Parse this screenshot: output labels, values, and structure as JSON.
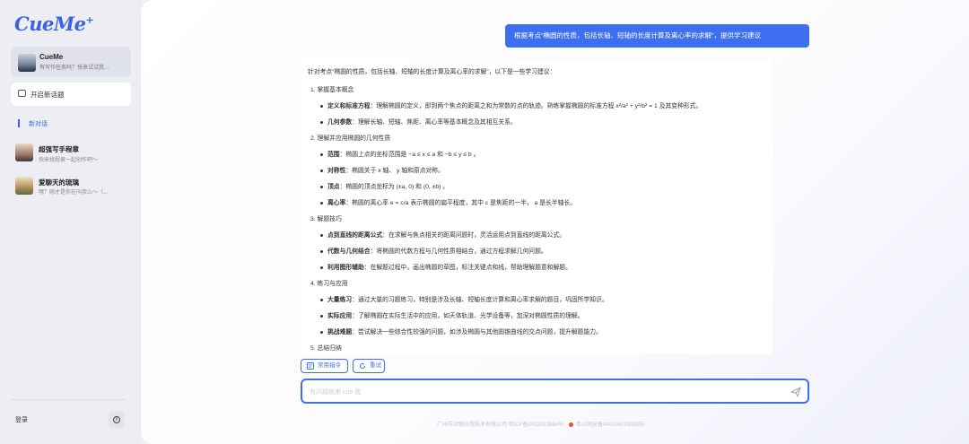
{
  "sidebar": {
    "logo": "CueMe",
    "logo_mark": "+",
    "bot": {
      "name": "CueMe",
      "subtitle": "有写作任务吗？快来试试我..."
    },
    "new_chat_label": "开启新话题",
    "section_label": "新对话",
    "conversations": [
      {
        "title": "超强写手程章",
        "subtitle": "快来找程章一起创作吧～"
      },
      {
        "title": "爱聊天的琉璃",
        "subtitle": "嘿？刚才是你在叫我么～（..."
      }
    ],
    "login_label": "登录",
    "info_icon": "i"
  },
  "chat": {
    "user_message": "根据考点“椭圆的性质，包括长轴、短轴的长度计算及离心率的求解”，提供学习建议",
    "answer": {
      "intro": "针对考点“椭圆的性质，包括长轴、短轴的长度计算及离心率的求解”，以下是一些学习建议：",
      "sections": [
        {
          "title": "1. 掌握基本概念",
          "items": [
            {
              "term": "定义和标准方程",
              "text": "：理解椭圆的定义，即到两个焦点的距离之和为常数的点的轨迹。熟练掌握椭圆的标准方程 x²/a² + y²/b² = 1 及其变种形式。"
            },
            {
              "term": "几何参数",
              "text": "：理解长轴、短轴、焦距、离心率等基本概念及其相互关系。"
            }
          ]
        },
        {
          "title": "2. 理解并应用椭圆的几何性质",
          "items": [
            {
              "term": "范围",
              "text": "：椭圆上点的坐标范围是 −a ≤ x ≤ a 和 −b ≤ y ≤ b 。"
            },
            {
              "term": "对称性",
              "text": "：椭圆关于 x 轴、 y 轴和原点对称。"
            },
            {
              "term": "顶点",
              "text": "：椭圆的顶点坐标为 (±a, 0) 和 (0, ±b) 。"
            },
            {
              "term": "离心率",
              "text": "：椭圆的离心率 e = c/a 表示椭圆的扁平程度，其中 c 是焦距的一半， a 是长半轴长。"
            }
          ]
        },
        {
          "title": "3. 解题技巧",
          "items": [
            {
              "term": "点到直线的距离公式",
              "text": "：在求解与焦点相关的距离问题时，灵活运用点到直线的距离公式。"
            },
            {
              "term": "代数与几何结合",
              "text": "：将椭圆的代数方程与几何性质相结合，通过方程求解几何问题。"
            },
            {
              "term": "利用图形辅助",
              "text": "：在解题过程中，画出椭圆的草图，标注关键点和线，帮助理解题意和解题。"
            }
          ]
        },
        {
          "title": "4. 练习与应用",
          "items": [
            {
              "term": "大量练习",
              "text": "：通过大量的习题练习，特别是涉及长轴、短轴长度计算和离心率求解的题目，巩固所学知识。"
            },
            {
              "term": "实际应用",
              "text": "：了解椭圆在实际生活中的应用，如天体轨道、光学设备等，加深对椭圆性质的理解。"
            },
            {
              "term": "挑战难题",
              "text": "：尝试解决一些综合性较强的问题，如涉及椭圆与其他圆锥曲线的交点问题，提升解题能力。"
            }
          ]
        },
        {
          "title": "5. 总结归纳",
          "items": []
        }
      ]
    },
    "chips": {
      "commands": "常用指令",
      "retry": "重试"
    },
    "input_placeholder": "有问题就来 cue 我"
  },
  "footer": {
    "company": "广州市动物狂想技术有限公司 粤ICP备2022013984号",
    "police": "粤公网安备44010502000055"
  },
  "colors": {
    "accent": "#3e6ff0",
    "sidebar_bg": "#eceef3"
  }
}
